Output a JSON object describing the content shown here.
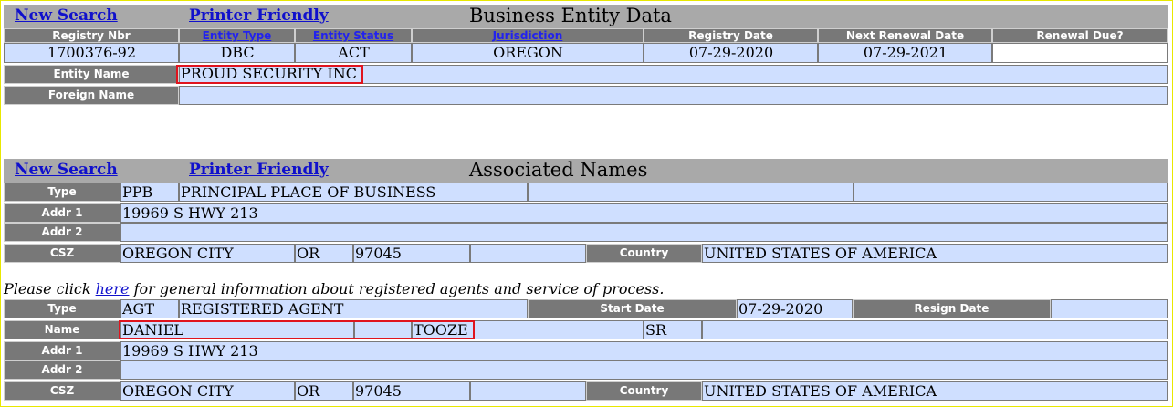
{
  "nav": {
    "new_search": "New Search",
    "printer_friendly": "Printer Friendly"
  },
  "business": {
    "title": "Business Entity Data",
    "headers": {
      "registry_nbr": "Registry Nbr",
      "entity_type": "Entity Type",
      "entity_status": "Entity Status",
      "jurisdiction": "Jurisdiction",
      "registry_date": "Registry Date",
      "next_renewal_date": "Next Renewal Date",
      "renewal_due": "Renewal Due?"
    },
    "values": {
      "registry_nbr": "1700376-92",
      "entity_type": "DBC",
      "entity_status": "ACT",
      "jurisdiction": "OREGON",
      "registry_date": "07-29-2020",
      "next_renewal_date": "07-29-2021",
      "renewal_due": ""
    },
    "entity_name_label": "Entity Name",
    "entity_name": "PROUD SECURITY INC",
    "foreign_name_label": "Foreign Name",
    "foreign_name": ""
  },
  "associated": {
    "title": "Associated Names",
    "labels": {
      "type": "Type",
      "addr1": "Addr 1",
      "addr2": "Addr 2",
      "csz": "CSZ",
      "country": "Country",
      "name": "Name",
      "start_date": "Start Date",
      "resign_date": "Resign Date"
    },
    "ppb": {
      "type_code": "PPB",
      "type_desc": "PRINCIPAL PLACE OF BUSINESS",
      "addr1": "19969 S HWY 213",
      "addr2": "",
      "city": "OREGON CITY",
      "state": "OR",
      "zip": "97045",
      "country": "UNITED STATES OF AMERICA"
    },
    "note_pre": "Please click ",
    "note_link": "here",
    "note_post": " for general information about registered agents and service of process.",
    "agent": {
      "type_code": "AGT",
      "type_desc": "REGISTERED AGENT",
      "start_date": "07-29-2020",
      "resign_date": "",
      "first_name": "DANIEL",
      "last_name": "TOOZE",
      "suffix": "SR",
      "addr1": "19969 S HWY 213",
      "addr2": "",
      "city": "OREGON CITY",
      "state": "OR",
      "zip": "97045",
      "country": "UNITED STATES OF AMERICA"
    }
  }
}
